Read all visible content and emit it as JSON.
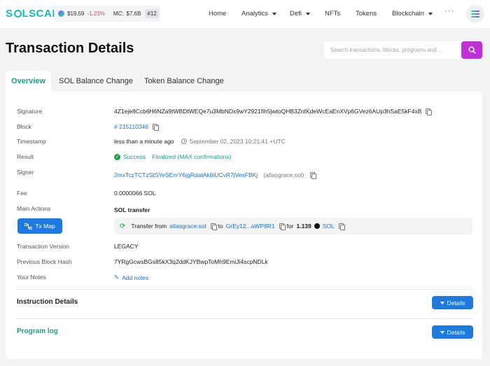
{
  "brand": {
    "name_part1": "S",
    "name_part2": "LSCAN"
  },
  "ticker": {
    "price": "$19.59",
    "change": "-1.23%",
    "mc_label": "MC:",
    "mc_value": "$7.6B",
    "rank": "#12"
  },
  "nav": {
    "home": "Home",
    "analytics": "Analytics",
    "defi": "Defi",
    "nfts": "NFTs",
    "tokens": "Tokens",
    "blockchain": "Blockchain",
    "more": "···"
  },
  "page": {
    "title": "Transaction Details"
  },
  "search": {
    "placeholder": "Search transactions, blocks, programs and..."
  },
  "tabs": [
    "Overview",
    "SOL Balance Change",
    "Token Balance Change"
  ],
  "details": {
    "signature": {
      "label": "Signature",
      "value": "4Z1eje8Ccb6H6NZa9tWBDtWEQe7u3MbNDx9wY2921fih5jwtoQHB3ZntKdeWcEaEnXVp6GVez6AUp3hSaE5kF4xB"
    },
    "block": {
      "label": "Block",
      "value": "# 215110346"
    },
    "timestamp": {
      "label": "Timestamp",
      "relative": "less than a minute ago",
      "absolute": "September 02, 2023 10:21:41 +UTC"
    },
    "result": {
      "label": "Result",
      "status": "Success",
      "finality": "Finalized (MAX confirmations)"
    },
    "signer": {
      "label": "Signer",
      "address": "2mxTczTCTzStSYeSEnrY6jgRdatAk8iUCvR7jVexFBKj",
      "alias": "(atlasgrace.sol)"
    },
    "fee": {
      "label": "Fee",
      "value": "0.0000066 SOL"
    },
    "main_actions": {
      "label": "Main Actions",
      "title": "SOL transfer",
      "txmap": "Tx Map",
      "transfer_from": "Transfer from",
      "from": "atlasgrace.sol",
      "to_word": "to",
      "to": "GrEy12...aWP8R1",
      "for_word": "for",
      "amount": "1.139",
      "token": "SOL"
    },
    "version": {
      "label": "Transaction Version",
      "value": "LEGACY"
    },
    "prev_hash": {
      "label": "Previous Block Hash",
      "value": "7YRgGcwsBGs85kX3q2ddKJYBwpToMh9EmiJi4scpNDLk"
    },
    "notes": {
      "label": "Your Notes",
      "value": "Add notes"
    }
  },
  "sections": {
    "instruction": {
      "title": "Instruction Details",
      "button": "Details"
    },
    "program_log": {
      "title": "Program log",
      "button": "Details"
    }
  },
  "colors": {
    "accent": "#14a08c",
    "link": "#1a73c8",
    "button": "#1f7ae0",
    "search_button": "#c22fd6",
    "success": "#16a34a"
  }
}
